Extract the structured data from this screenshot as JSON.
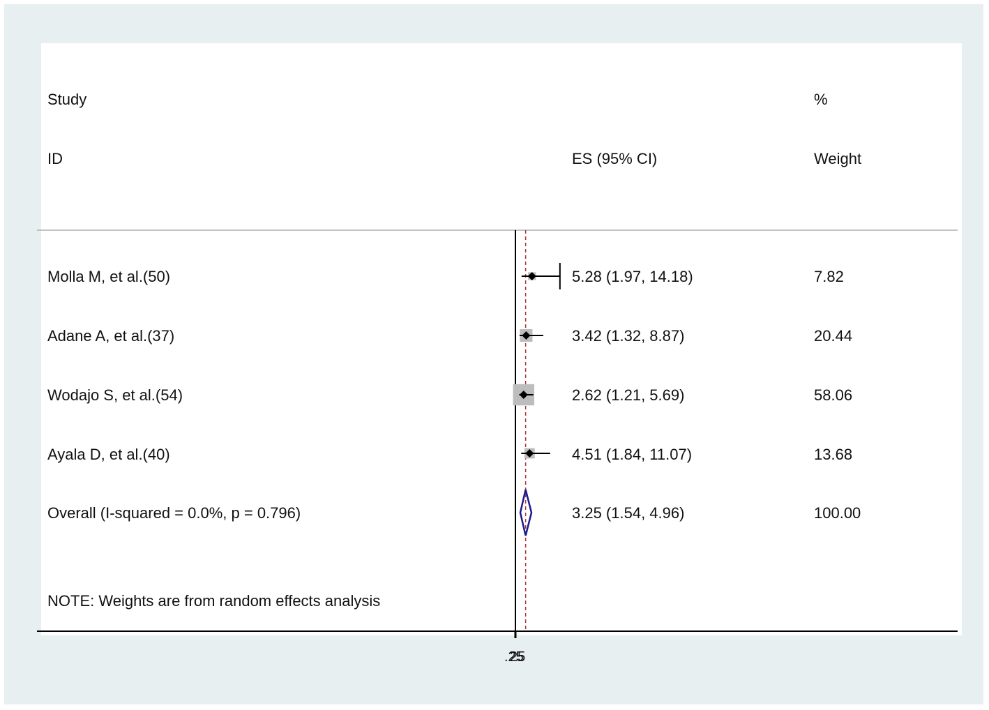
{
  "header": {
    "study_label": "Study",
    "id_label": "ID",
    "es_label": "ES (95% CI)",
    "pct_label": "%",
    "weight_label": "Weight"
  },
  "note": "NOTE: Weights are from random effects analysis",
  "colors": {
    "frame": "#e8eff1",
    "ci_line": "#000000",
    "weight_box": "#bdbdbd",
    "overall_diamond": "#1a1a8c",
    "ref_line": "#b03030"
  },
  "chart_data": {
    "type": "forest",
    "studies": [
      {
        "id": "Molla M, et al.(50)",
        "es": 5.28,
        "lo": 1.97,
        "hi": 14.18,
        "es_text": "5.28 (1.97, 14.18)",
        "weight": 7.82,
        "weight_text": "7.82"
      },
      {
        "id": "Adane A, et al.(37)",
        "es": 3.42,
        "lo": 1.32,
        "hi": 8.87,
        "es_text": "3.42 (1.32, 8.87)",
        "weight": 20.44,
        "weight_text": "20.44"
      },
      {
        "id": "Wodajo S, et al.(54)",
        "es": 2.62,
        "lo": 1.21,
        "hi": 5.69,
        "es_text": "2.62 (1.21, 5.69)",
        "weight": 58.06,
        "weight_text": "58.06"
      },
      {
        "id": "Ayala D, et al.(40)",
        "es": 4.51,
        "lo": 1.84,
        "hi": 11.07,
        "es_text": "4.51 (1.84, 11.07)",
        "weight": 13.68,
        "weight_text": "13.68"
      }
    ],
    "overall": {
      "id": "Overall  (I-squared = 0.0%, p = 0.796)",
      "es": 3.25,
      "lo": 1.54,
      "hi": 4.96,
      "es_text": "3.25 (1.54, 4.96)",
      "weight": 100.0,
      "weight_text": "100.00"
    },
    "null_line": 0,
    "x_tick_labels": [
      ".25",
      "25"
    ]
  }
}
